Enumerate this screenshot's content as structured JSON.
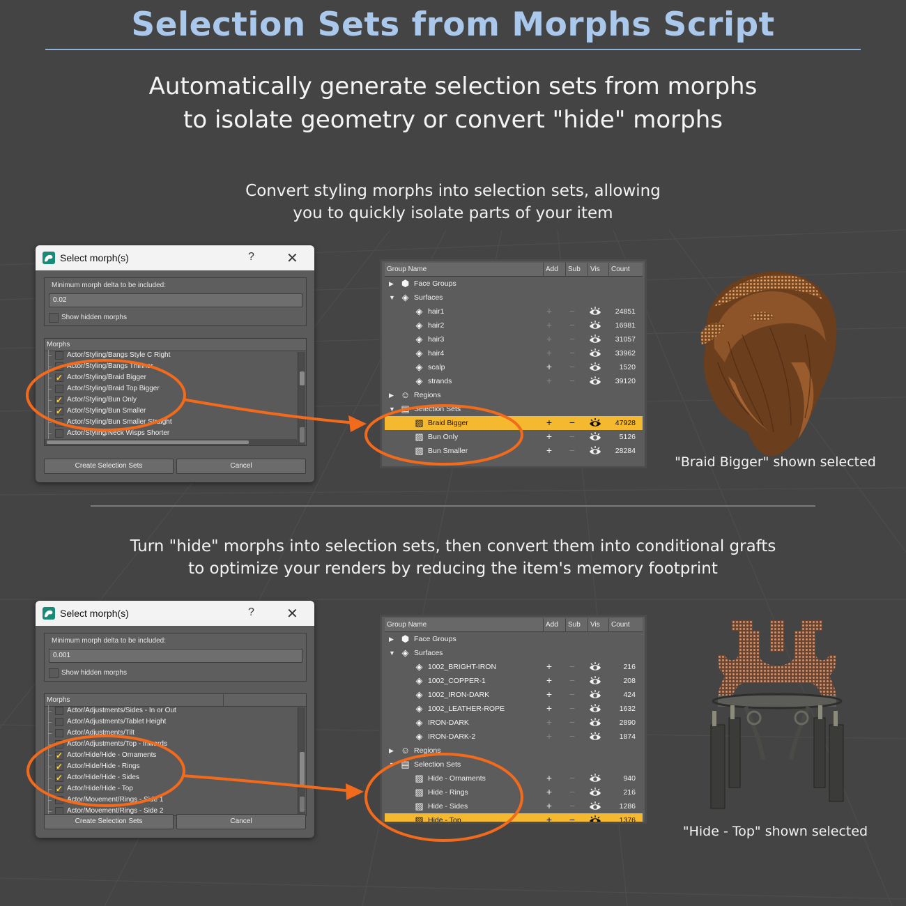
{
  "header": {
    "title": "Selection Sets from Morphs Script",
    "subtitle_line1": "Automatically generate selection sets from morphs",
    "subtitle_line2": "to isolate geometry or convert \"hide\" morphs"
  },
  "section1": {
    "caption_line1": "Convert styling morphs into selection sets, allowing",
    "caption_line2": "you to quickly isolate parts of your item",
    "dialog": {
      "title": "Select morph(s)",
      "help": "?",
      "close": "✕",
      "min_delta_label": "Minimum morph delta to be included:",
      "min_delta_value": "0.02",
      "show_hidden_label": "Show hidden morphs",
      "morphs_header": "Morphs",
      "morphs": [
        {
          "label": "Actor/Styling/Bangs Style C Right",
          "checked": false
        },
        {
          "label": "Actor/Styling/Bangs Thinner",
          "checked": false
        },
        {
          "label": "Actor/Styling/Braid Bigger",
          "checked": true
        },
        {
          "label": "Actor/Styling/Braid Top Bigger",
          "checked": false
        },
        {
          "label": "Actor/Styling/Bun Only",
          "checked": true
        },
        {
          "label": "Actor/Styling/Bun Smaller",
          "checked": true
        },
        {
          "label": "Actor/Styling/Bun Smaller Straight",
          "checked": false
        },
        {
          "label": "Actor/Styling/Neck Wisps Shorter",
          "checked": false
        }
      ],
      "create_button": "Create Selection Sets",
      "cancel_button": "Cancel"
    },
    "groups": {
      "headers": {
        "name": "Group Name",
        "add": "Add",
        "sub": "Sub",
        "vis": "Vis",
        "count": "Count"
      },
      "face_groups": "Face Groups",
      "surfaces": "Surfaces",
      "surface_rows": [
        {
          "name": "hair1",
          "count": "24851"
        },
        {
          "name": "hair2",
          "count": "16981"
        },
        {
          "name": "hair3",
          "count": "31057"
        },
        {
          "name": "hair4",
          "count": "33962"
        },
        {
          "name": "scalp",
          "count": "1520"
        },
        {
          "name": "strands",
          "count": "39120"
        }
      ],
      "regions": "Regions",
      "selection_sets": "Selection Sets",
      "set_rows": [
        {
          "name": "Braid Bigger",
          "count": "47928"
        },
        {
          "name": "Bun Only",
          "count": "5126"
        },
        {
          "name": "Bun Smaller",
          "count": "28284"
        }
      ],
      "plus": "+",
      "minus": "−"
    },
    "image_label": "\"Braid Bigger\" shown selected"
  },
  "section2": {
    "caption_line1": "Turn \"hide\" morphs into selection sets, then convert them into conditional grafts",
    "caption_line2": "to optimize your renders by reducing the item's memory footprint",
    "dialog": {
      "title": "Select morph(s)",
      "help": "?",
      "close": "✕",
      "min_delta_label": "Minimum morph delta to be included:",
      "min_delta_value": "0.001",
      "show_hidden_label": "Show hidden morphs",
      "morphs_header": "Morphs",
      "morphs": [
        {
          "label": "Actor/Adjustments/Sides - In or Out",
          "checked": false
        },
        {
          "label": "Actor/Adjustments/Tablet Height",
          "checked": false
        },
        {
          "label": "Actor/Adjustments/Tilt",
          "checked": false
        },
        {
          "label": "Actor/Adjustments/Top - Inwards",
          "checked": false
        },
        {
          "label": "Actor/Hide/Hide - Ornaments",
          "checked": true
        },
        {
          "label": "Actor/Hide/Hide - Rings",
          "checked": true
        },
        {
          "label": "Actor/Hide/Hide - Sides",
          "checked": true
        },
        {
          "label": "Actor/Hide/Hide - Top",
          "checked": true
        },
        {
          "label": "Actor/Movement/Rings - Side 1",
          "checked": false
        },
        {
          "label": "Actor/Movement/Rings - Side 2",
          "checked": false
        }
      ],
      "create_button": "Create Selection Sets",
      "cancel_button": "Cancel"
    },
    "groups": {
      "headers": {
        "name": "Group Name",
        "add": "Add",
        "sub": "Sub",
        "vis": "Vis",
        "count": "Count"
      },
      "face_groups": "Face Groups",
      "surfaces": "Surfaces",
      "surface_rows": [
        {
          "name": "1002_BRIGHT-IRON",
          "count": "216"
        },
        {
          "name": "1002_COPPER-1",
          "count": "208"
        },
        {
          "name": "1002_IRON-DARK",
          "count": "424"
        },
        {
          "name": "1002_LEATHER-ROPE",
          "count": "1632"
        },
        {
          "name": "IRON-DARK",
          "count": "2890"
        },
        {
          "name": "IRON-DARK-2",
          "count": "1874"
        }
      ],
      "regions": "Regions",
      "selection_sets": "Selection Sets",
      "set_rows": [
        {
          "name": "Hide - Ornaments",
          "count": "940"
        },
        {
          "name": "Hide - Rings",
          "count": "216"
        },
        {
          "name": "Hide - Sides",
          "count": "1286"
        },
        {
          "name": "Hide - Top",
          "count": "1376"
        }
      ],
      "plus": "+",
      "minus": "−"
    },
    "image_label": "\"Hide - Top\" shown selected"
  },
  "colors": {
    "background": "#444444",
    "title": "#a9c8ec",
    "selected_row": "#f5b92f",
    "annotation": "#f26a1b",
    "checkmark": "#ffd23d"
  }
}
